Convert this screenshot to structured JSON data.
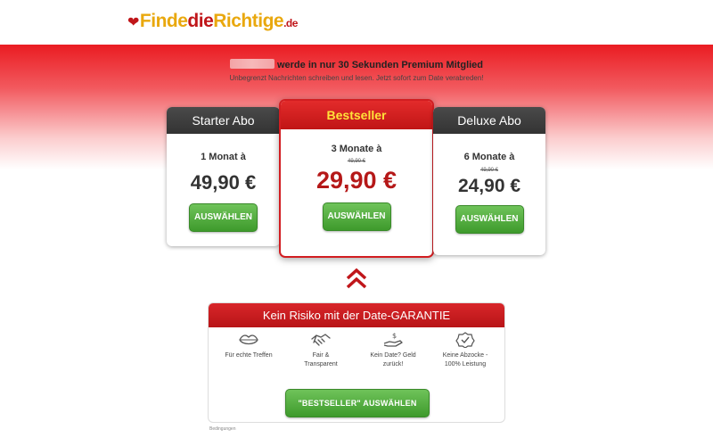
{
  "header": {
    "logo": {
      "part1": "Finde",
      "part2": "die",
      "part3": "Richtige",
      "tld": ".de"
    }
  },
  "promo": {
    "headline": "werde in nur 30 Sekunden Premium Mitglied",
    "subline": "Unbegrenzt Nachrichten schreiben und lesen. Jetzt sofort zum Date verabreden!"
  },
  "plans": [
    {
      "title": "Starter Abo",
      "period": "1 Monat à",
      "old_price": "",
      "price": "49,90 €",
      "button": "AUSWÄHLEN"
    },
    {
      "title": "Bestseller",
      "period": "3 Monate à",
      "old_price": "49,90 €",
      "price": "29,90 €",
      "button": "AUSWÄHLEN"
    },
    {
      "title": "Deluxe Abo",
      "period": "6 Monate à",
      "old_price": "49,90 €",
      "price": "24,90 €",
      "button": "AUSWÄHLEN"
    }
  ],
  "guarantee": {
    "title": "Kein Risiko mit der Date-GARANTIE",
    "features": [
      {
        "icon": "lips-icon",
        "label_l1": "Für echte Treffen",
        "label_l2": ""
      },
      {
        "icon": "handshake-icon",
        "label_l1": "Fair &",
        "label_l2": "Transparent"
      },
      {
        "icon": "money-hand-icon",
        "label_l1": "Kein Date? Geld",
        "label_l2": "zurück!"
      },
      {
        "icon": "check-badge-icon",
        "label_l1": "Keine Abzocke -",
        "label_l2": "100% Leistung"
      }
    ],
    "button": "\"BESTSELLER\" AUSWÄHLEN"
  },
  "footer": {
    "terms": "Bedingungen"
  },
  "colors": {
    "brand_red": "#c0161a",
    "brand_gold": "#e9a80e",
    "button_green": "#4caf34",
    "price_red": "#b51818"
  }
}
